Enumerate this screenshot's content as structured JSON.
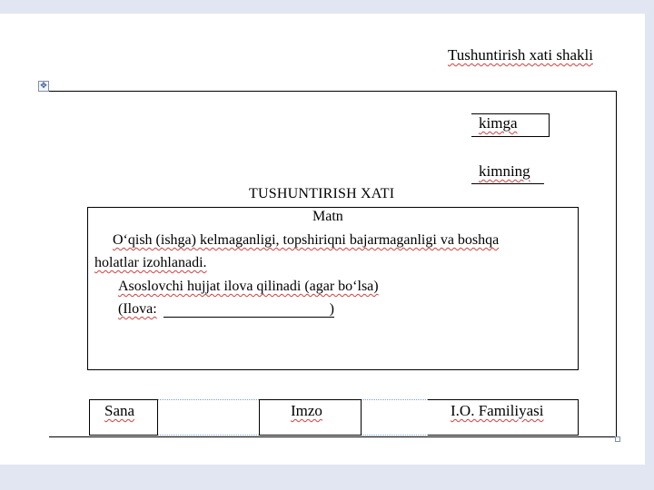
{
  "form_title": "Tushuntirish xati shakli",
  "recipient": {
    "to_label": "kimga",
    "from_label": "kimning"
  },
  "document_title": "TUSHUNTIRISH XATI",
  "body": {
    "heading": "Matn",
    "line1": "O‘qish (ishga) kelmaganligi, topshiriqni bajarmaganligi va boshqa",
    "line2": "holatlar izohlanadi.",
    "line3": "Asoslovchi hujjat ilova qilinadi (agar bo‘lsa)",
    "line4_prefix": "(Ilova:",
    "line4_suffix": ")"
  },
  "footer": {
    "date_label": "Sana",
    "signature_label": "Imzo",
    "name_label": "I.O. Familiyasi"
  },
  "anchor_glyph": "✥"
}
